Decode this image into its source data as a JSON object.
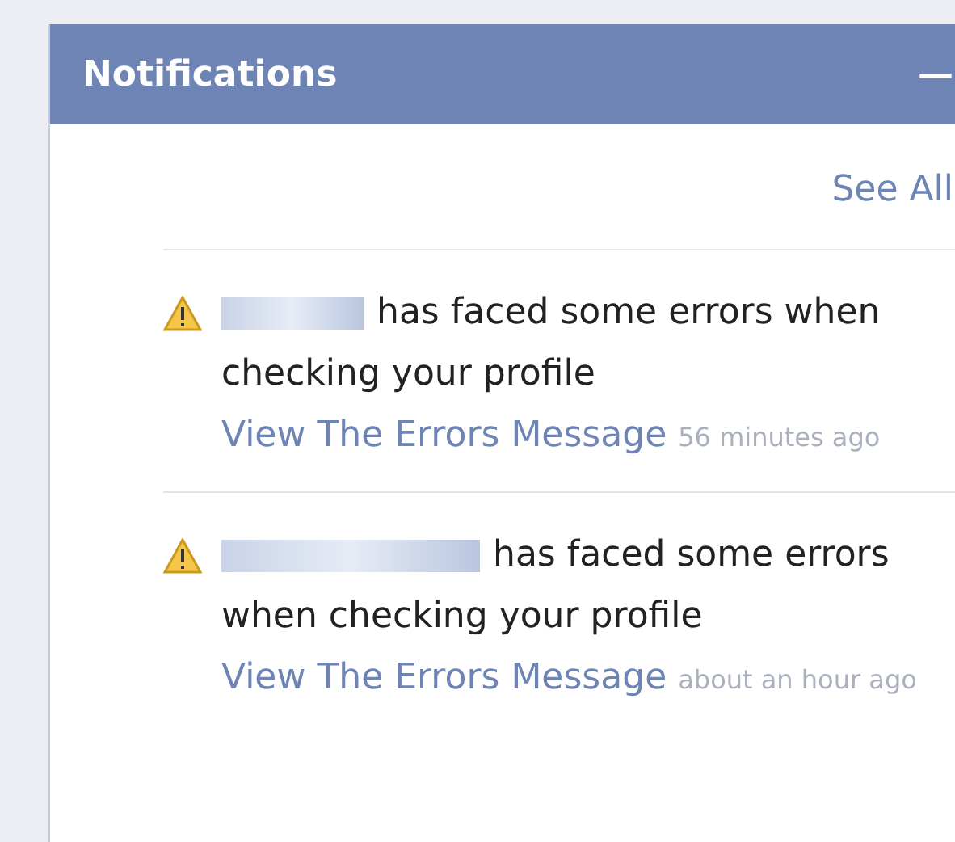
{
  "panel": {
    "title": "Notifications",
    "minimize": "—"
  },
  "see_all": "See All",
  "notifications": [
    {
      "text": "has faced some errors when checking your profile",
      "link": "View The Errors Message",
      "time": "56 minutes ago"
    },
    {
      "text": "has faced some errors when checking your profile",
      "link": "View The Errors Message",
      "time": "about an hour ago"
    }
  ]
}
